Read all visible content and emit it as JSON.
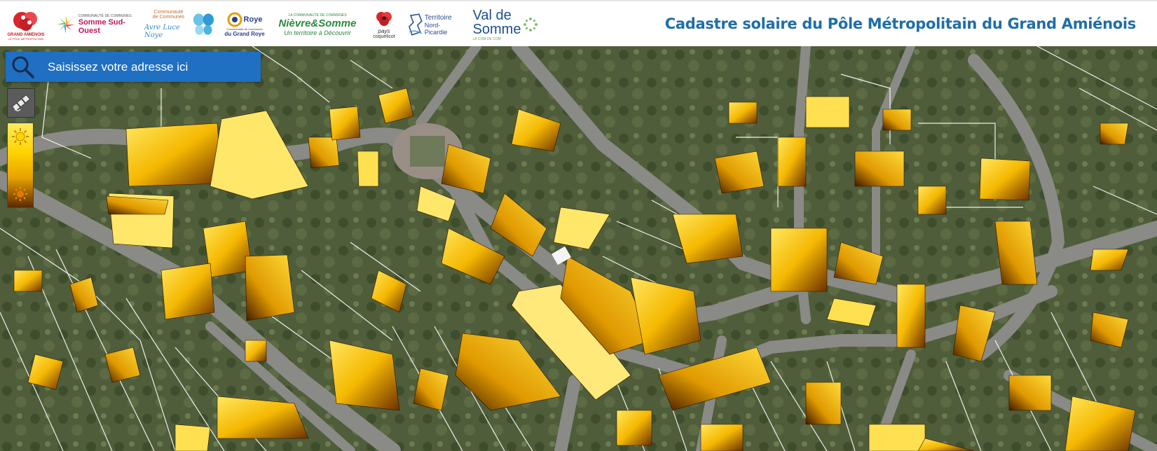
{
  "header": {
    "title": "Cadastre solaire du Pôle Métropolitain du Grand Amiénois",
    "logos": [
      {
        "name": "grand-amienois-logo",
        "lines": [
          "GRAND AMIÉNOIS",
          "LE PÔLE MÉTROPOLITAIN"
        ]
      },
      {
        "name": "somme-sud-ouest-logo",
        "lines": [
          "COMMUNAUTÉ DE COMMUNES",
          "Somme Sud-Ouest"
        ]
      },
      {
        "name": "avre-luce-noye-logo",
        "lines": [
          "Communauté",
          "de Communes",
          "Avre Luce Noye"
        ]
      },
      {
        "name": "grand-roye-logo",
        "lines": [
          "Roye",
          "Communauté de Communes",
          "du Grand Roye"
        ]
      },
      {
        "name": "nievre-somme-logo",
        "lines": [
          "LA COMMUNAUTÉ DE COMMUNES",
          "Nièvre&Somme",
          "Un territoire à Découvrir"
        ]
      },
      {
        "name": "pays-coquelicot-logo",
        "lines": [
          "pays",
          "coquelicot"
        ]
      },
      {
        "name": "territoire-nord-picardie-logo",
        "lines": [
          "Territoire",
          "Nord-Picardie"
        ]
      },
      {
        "name": "val-de-somme-logo",
        "lines": [
          "Val de",
          "Somme",
          "LA COM DE COM"
        ]
      }
    ]
  },
  "search": {
    "placeholder": "Saisissez votre adresse ici"
  },
  "tools": {
    "layer_toggle_icon": "satellite-icon",
    "legend_high_icon": "sun-bright-icon",
    "legend_low_icon": "sun-dim-icon"
  },
  "colors": {
    "brand_blue": "#1f6ea8",
    "search_blue": "#1f6fc2",
    "solar_high": "#ffe45c",
    "solar_mid": "#f0b400",
    "solar_low": "#4a1e00"
  }
}
